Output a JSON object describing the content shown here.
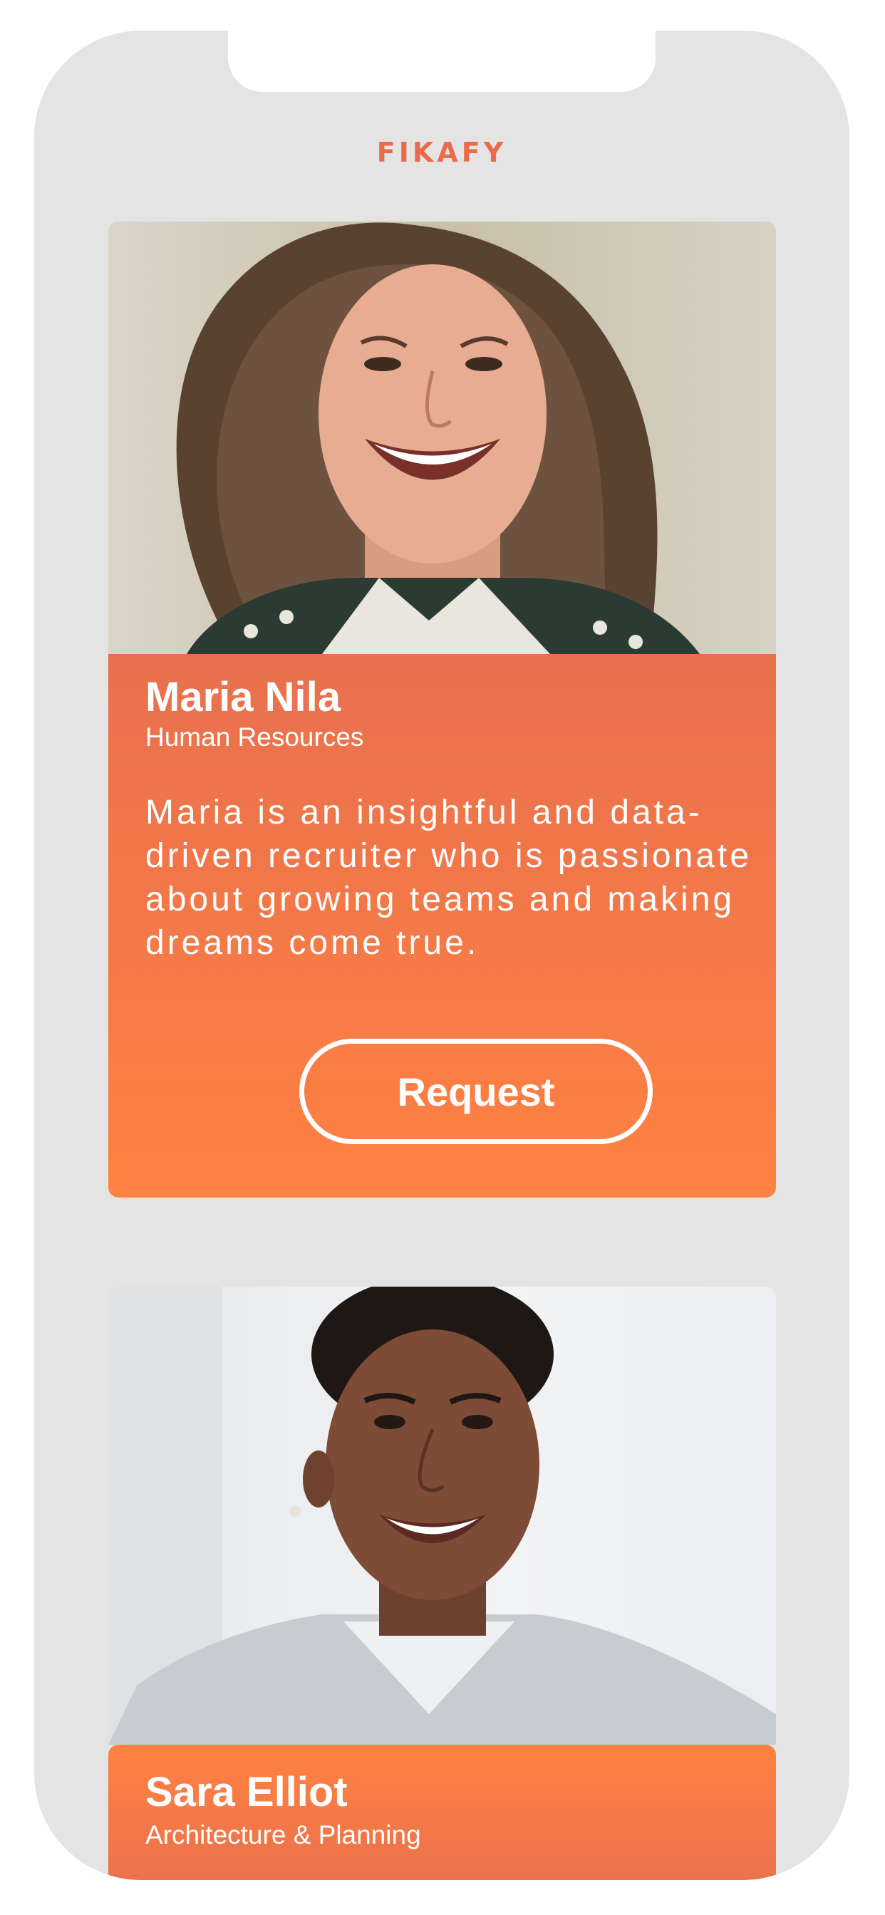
{
  "app": {
    "brand": "FIKAFY",
    "brand_color": "#e96b4c",
    "accent_color": "#ff8242"
  },
  "profiles": [
    {
      "name": "Maria Nila",
      "department": "Human Resources",
      "bio": "Maria is an insightful and data-driven recruiter who is passionate about growing teams and making dreams come true.",
      "button_label": "Request"
    },
    {
      "name": "Sara Elliot",
      "department": "Architecture & Planning"
    }
  ]
}
